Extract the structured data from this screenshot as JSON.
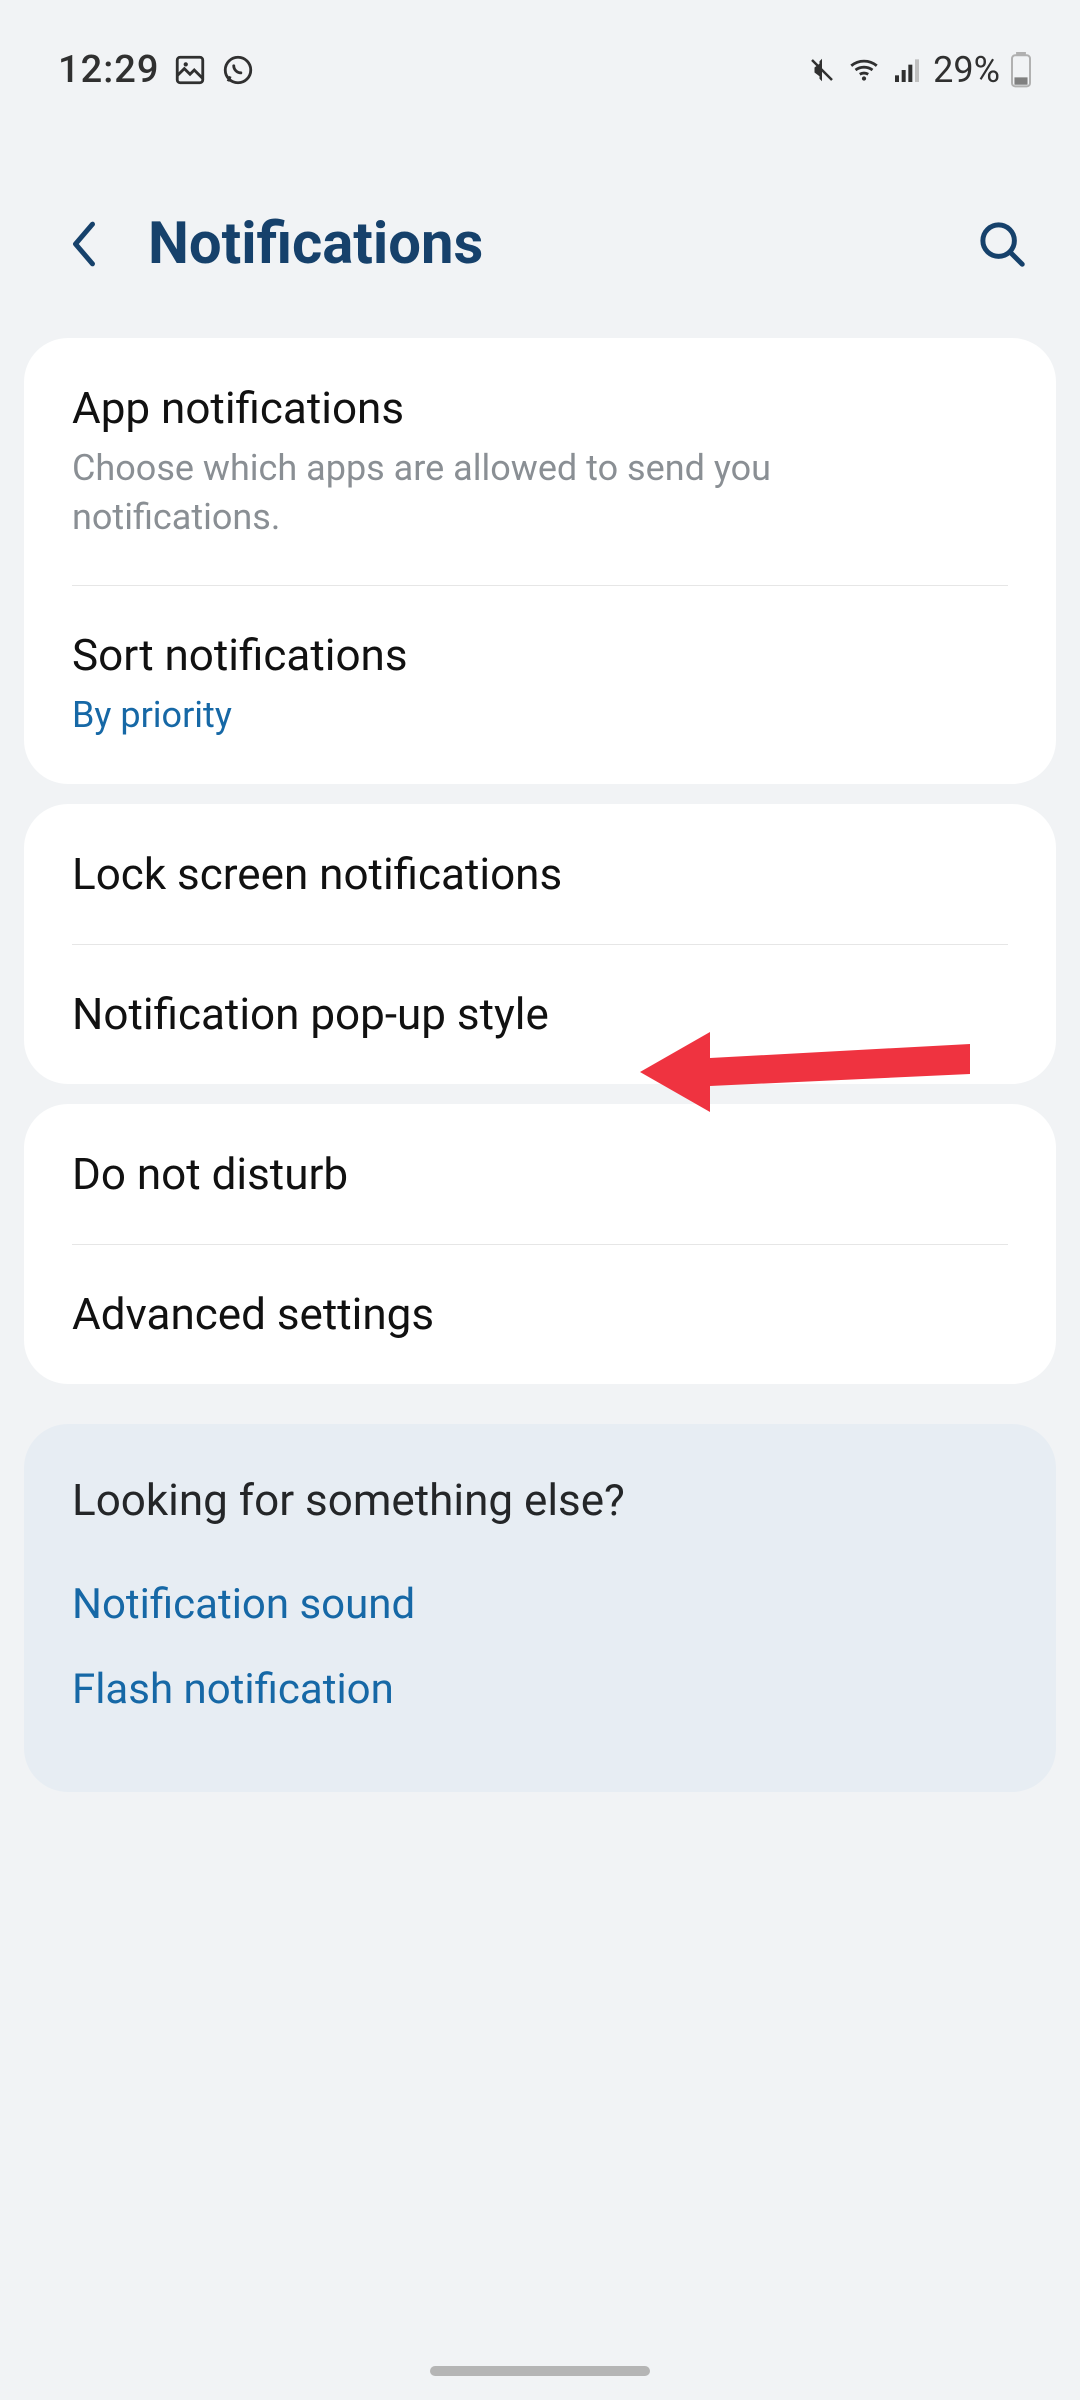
{
  "status": {
    "time": "12:29",
    "battery_text": "29%"
  },
  "header": {
    "title": "Notifications"
  },
  "group1": {
    "app_notifications": {
      "title": "App notifications",
      "sub": "Choose which apps are allowed to send you notifications."
    },
    "sort_notifications": {
      "title": "Sort notifications",
      "sub": "By priority"
    }
  },
  "group2": {
    "lock_screen": {
      "title": "Lock screen notifications"
    },
    "popup_style": {
      "title": "Notification pop-up style"
    }
  },
  "group3": {
    "dnd": {
      "title": "Do not disturb"
    },
    "advanced": {
      "title": "Advanced settings"
    }
  },
  "suggestions": {
    "heading": "Looking for something else?",
    "links": [
      "Notification sound",
      "Flash notification"
    ]
  }
}
